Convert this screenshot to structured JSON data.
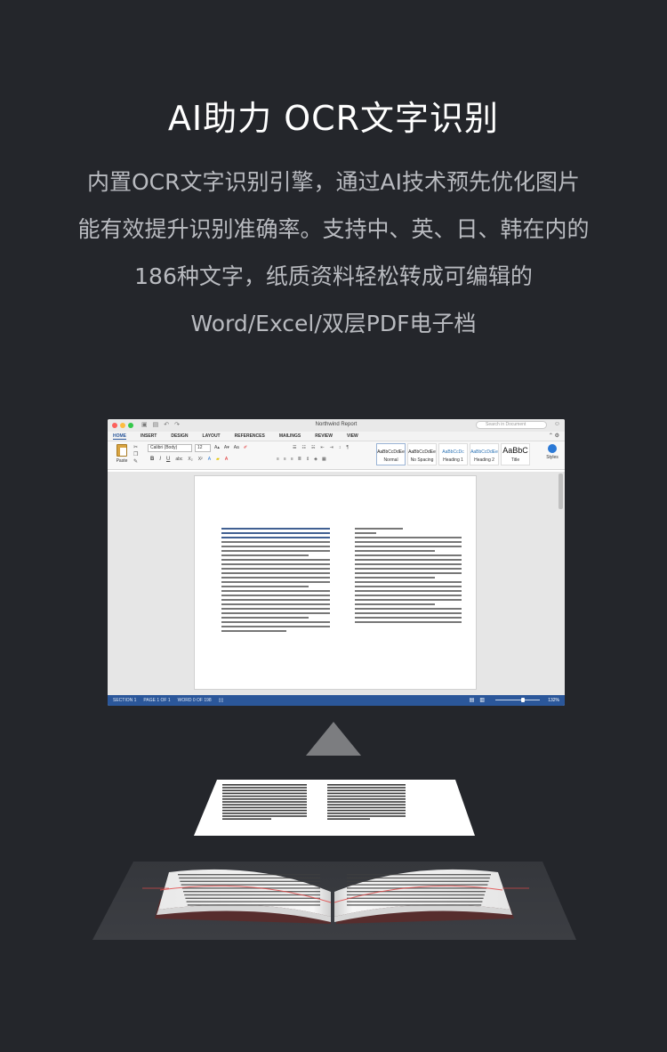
{
  "heading": "AI助力 OCR文字识别",
  "description": [
    "内置OCR文字识别引擎，通过AI技术预先优化图片",
    "能有效提升识别准确率。支持中、英、日、韩在内的",
    "186种文字，纸质资料轻松转成可编辑的",
    "Word/Excel/双层PDF电子档"
  ],
  "word_window": {
    "title": "Northwind Report",
    "search_placeholder": "Search in Document",
    "tabs": [
      "HOME",
      "INSERT",
      "DESIGN",
      "LAYOUT",
      "REFERENCES",
      "MAILINGS",
      "REVIEW",
      "VIEW"
    ],
    "paste_label": "Paste",
    "font_name": "Calibri (Body)",
    "font_size": "12",
    "styles": [
      {
        "sample": "AaBbCcDdEe",
        "label": "Normal"
      },
      {
        "sample": "AaBbCcDdEe",
        "label": "No Spacing"
      },
      {
        "sample": "AaBbCcDc",
        "label": "Heading 1"
      },
      {
        "sample": "AaBbCcDdEe",
        "label": "Heading 2"
      },
      {
        "sample": "AaBbC",
        "label": "Title"
      }
    ],
    "styles_button": "Styles",
    "status": {
      "section": "SECTION 1",
      "page": "PAGE 1 OF 1",
      "words": "WORD 0 OF 198",
      "zoom": "132%"
    }
  },
  "colors": {
    "background": "#24262b",
    "heading": "#ffffff",
    "description": "#b9bbc0",
    "word_accent": "#2b579a",
    "arrow": "#7c7d80"
  }
}
